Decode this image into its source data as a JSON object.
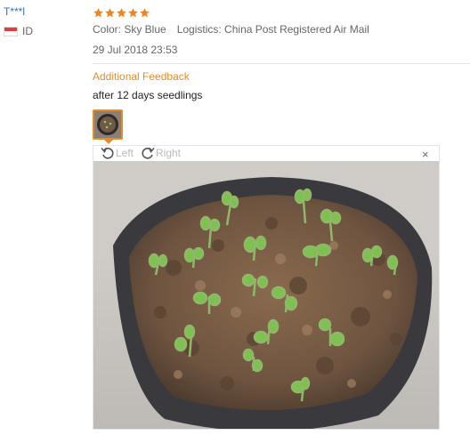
{
  "review": {
    "user_name": "T***l",
    "country": "ID",
    "rating": 5,
    "color": "Color: Sky Blue",
    "logistics": "Logistics: China Post Registered Air Mail",
    "date": "29 Jul 2018 23:53",
    "additional_feedback_label": "Additional Feedback",
    "feedback_text": "after 12 days seedlings"
  },
  "viewer": {
    "rotate_left_label": "Left",
    "rotate_right_label": "Right",
    "close_glyph": "×"
  },
  "colors": {
    "accent": "#e48c2b",
    "star": "#f0841d",
    "link": "#3a6fb0"
  },
  "icons": [
    "star-icon",
    "id-flag-icon",
    "rotate-left-icon",
    "rotate-right-icon",
    "close-icon"
  ]
}
